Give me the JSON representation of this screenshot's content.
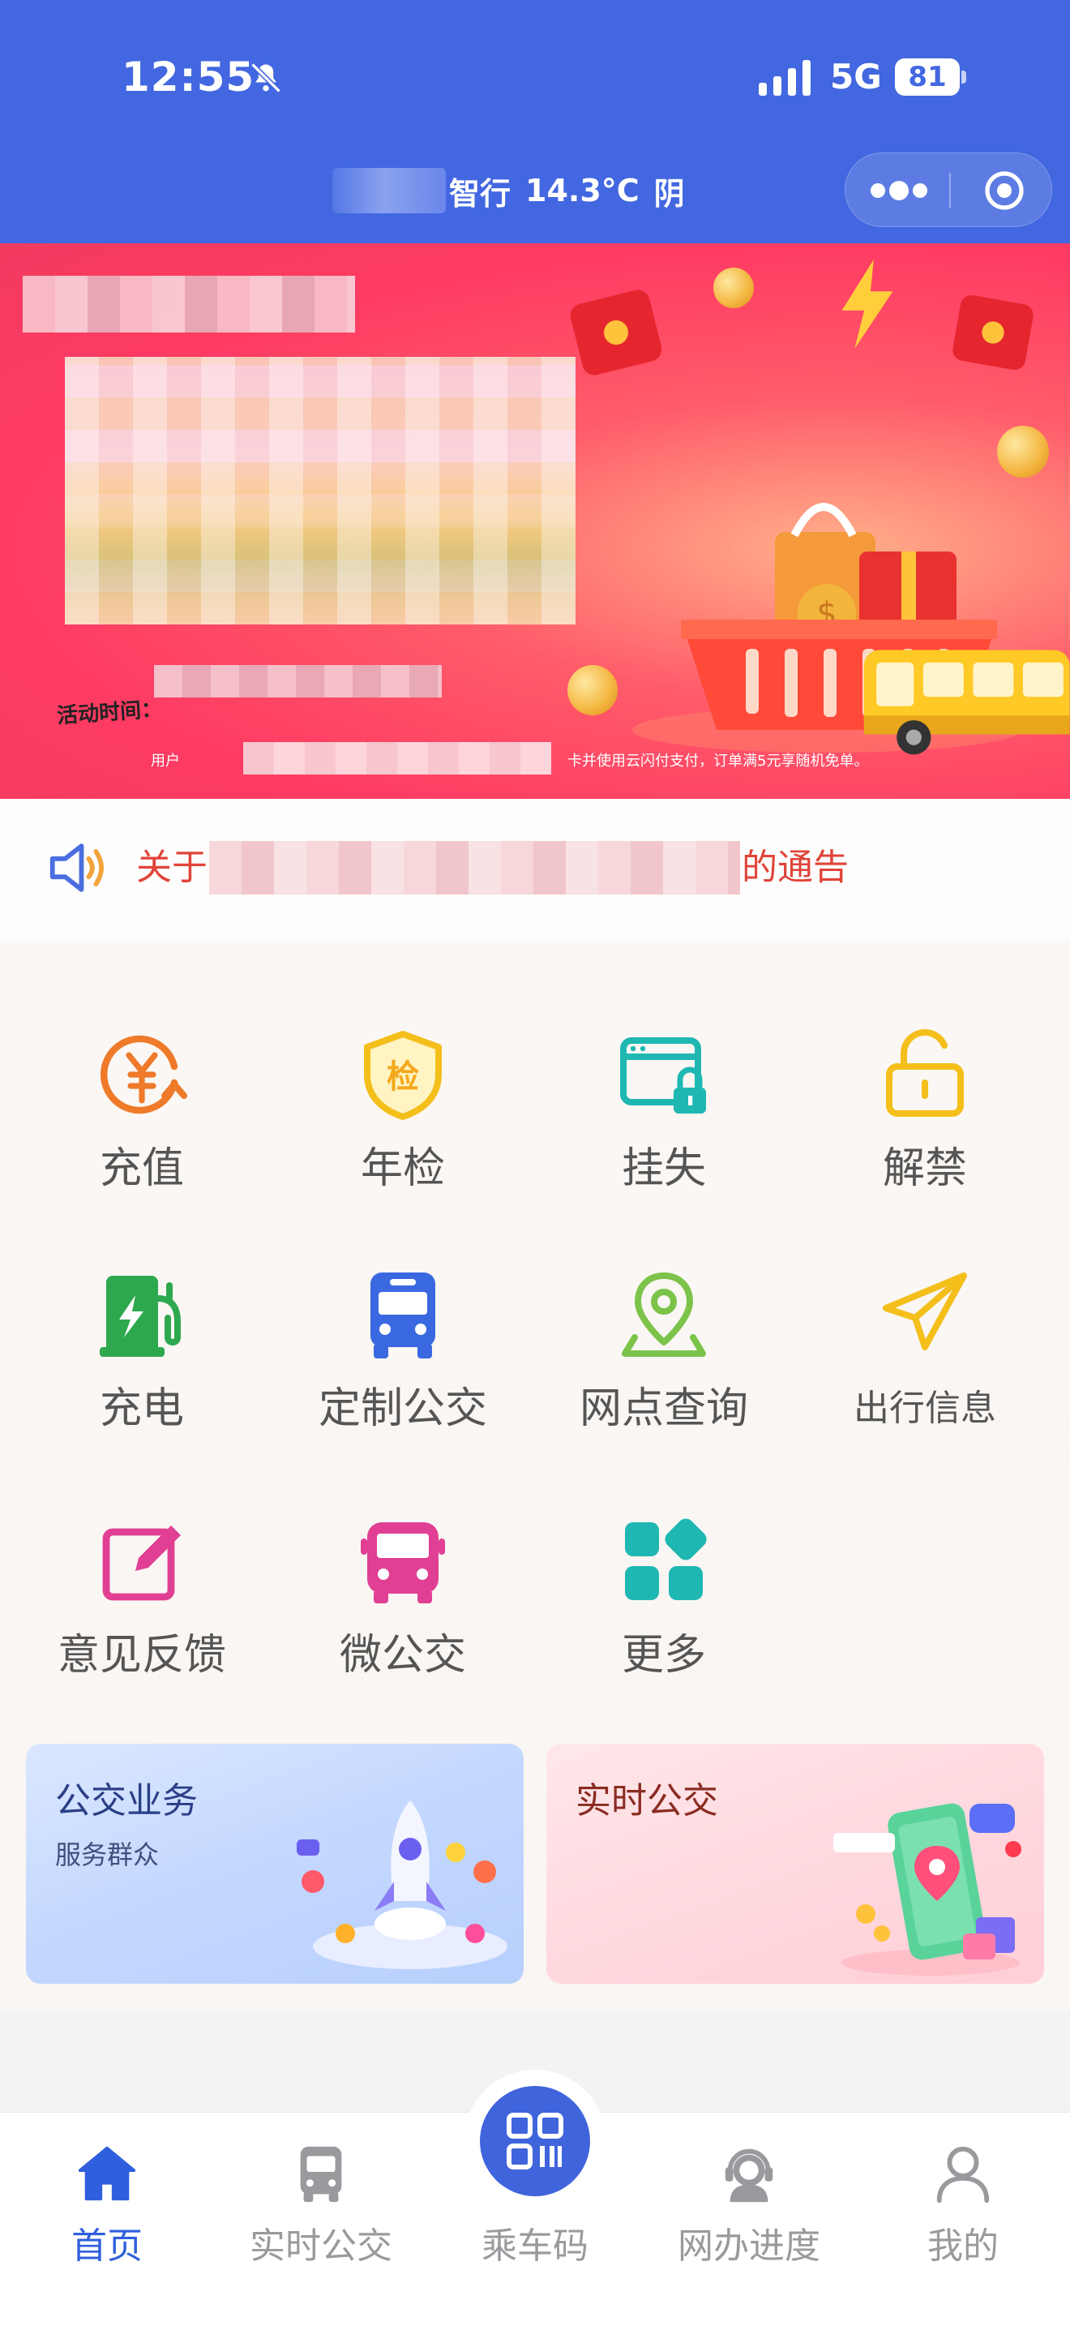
{
  "status_bar": {
    "time": "12:55",
    "network": "5G",
    "battery": "81"
  },
  "header": {
    "weather_prefix": "智行",
    "temperature": "14.3°C",
    "condition": "阴"
  },
  "banner": {
    "activity_label": "活动时间：",
    "fine_print_left": "用户",
    "fine_print_right": "卡并使用云闪付支付，订单满5元享随机免单。"
  },
  "notice": {
    "prefix": "关于",
    "suffix": "的通告"
  },
  "services": [
    {
      "label": "充值",
      "icon": "yuan-recharge-icon"
    },
    {
      "label": "年检",
      "icon": "inspection-shield-icon",
      "badge": "检"
    },
    {
      "label": "挂失",
      "icon": "card-lock-icon"
    },
    {
      "label": "解禁",
      "icon": "unlock-icon"
    },
    {
      "label": "充电",
      "icon": "charging-station-icon"
    },
    {
      "label": "定制公交",
      "icon": "bus-icon"
    },
    {
      "label": "网点查询",
      "icon": "location-pin-icon"
    },
    {
      "label": "出行信息",
      "icon": "paper-plane-icon"
    },
    {
      "label": "意见反馈",
      "icon": "edit-note-icon"
    },
    {
      "label": "微公交",
      "icon": "mini-bus-icon"
    },
    {
      "label": "更多",
      "icon": "grid-more-icon"
    }
  ],
  "cards": {
    "bus_business": {
      "title": "公交业务",
      "subtitle": "服务群众"
    },
    "realtime_bus": {
      "title": "实时公交"
    }
  },
  "tabbar": [
    {
      "label": "首页",
      "icon": "home-icon",
      "active": true
    },
    {
      "label": "实时公交",
      "icon": "bus-icon"
    },
    {
      "label": "乘车码",
      "icon": "qr-code-icon"
    },
    {
      "label": "网办进度",
      "icon": "support-agent-icon"
    },
    {
      "label": "我的",
      "icon": "user-icon"
    }
  ],
  "colors": {
    "header_blue": "#4267e0",
    "accent_blue": "#2f5fdc",
    "notice_red": "#e04438",
    "orange": "#ee7a2a",
    "yellow": "#f4bf1b",
    "teal": "#1fb7b2",
    "green": "#2ea84e",
    "blue": "#3a68e0",
    "lime": "#7cc34a",
    "magenta": "#e03f94"
  }
}
